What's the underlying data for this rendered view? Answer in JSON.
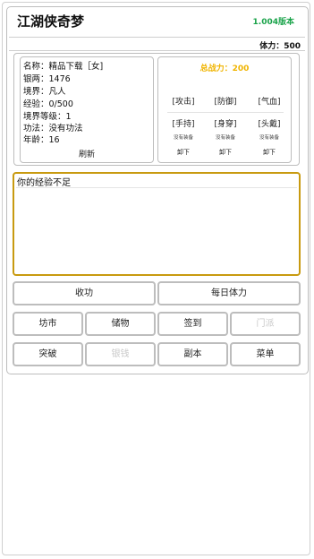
{
  "app": {
    "title": "江湖侠奇梦",
    "version": "1.004版本"
  },
  "status": {
    "stamina": "体力：500"
  },
  "character": {
    "lines": [
      "名称：精品下载［女]",
      "银两：1476",
      "境界：凡人",
      "经验：0/500",
      "境界等级：1",
      "功法：没有功法",
      "年龄：16"
    ],
    "refresh_label": "刷新"
  },
  "equipment": {
    "power": "总战力：200",
    "stats": [
      "[攻击]",
      "[防御]",
      "[气血]"
    ],
    "slots": [
      {
        "label": "[手持]",
        "value": "没有装备",
        "action": "卸下"
      },
      {
        "label": "[身穿]",
        "value": "没有装备",
        "action": "卸下"
      },
      {
        "label": "[头戴]",
        "value": "没有装备",
        "action": "卸下"
      }
    ]
  },
  "message": {
    "text": "你的经验不足"
  },
  "buttons": {
    "row1": [
      "收功",
      "每日体力"
    ],
    "row2": [
      "坊市",
      "储物",
      "签到",
      "门派"
    ],
    "row3": [
      "突破",
      "银钱",
      "副本",
      "菜单"
    ]
  },
  "colors": {
    "version": "#1aa34a",
    "power": "#f0b400",
    "message_border": "#c89a10"
  }
}
